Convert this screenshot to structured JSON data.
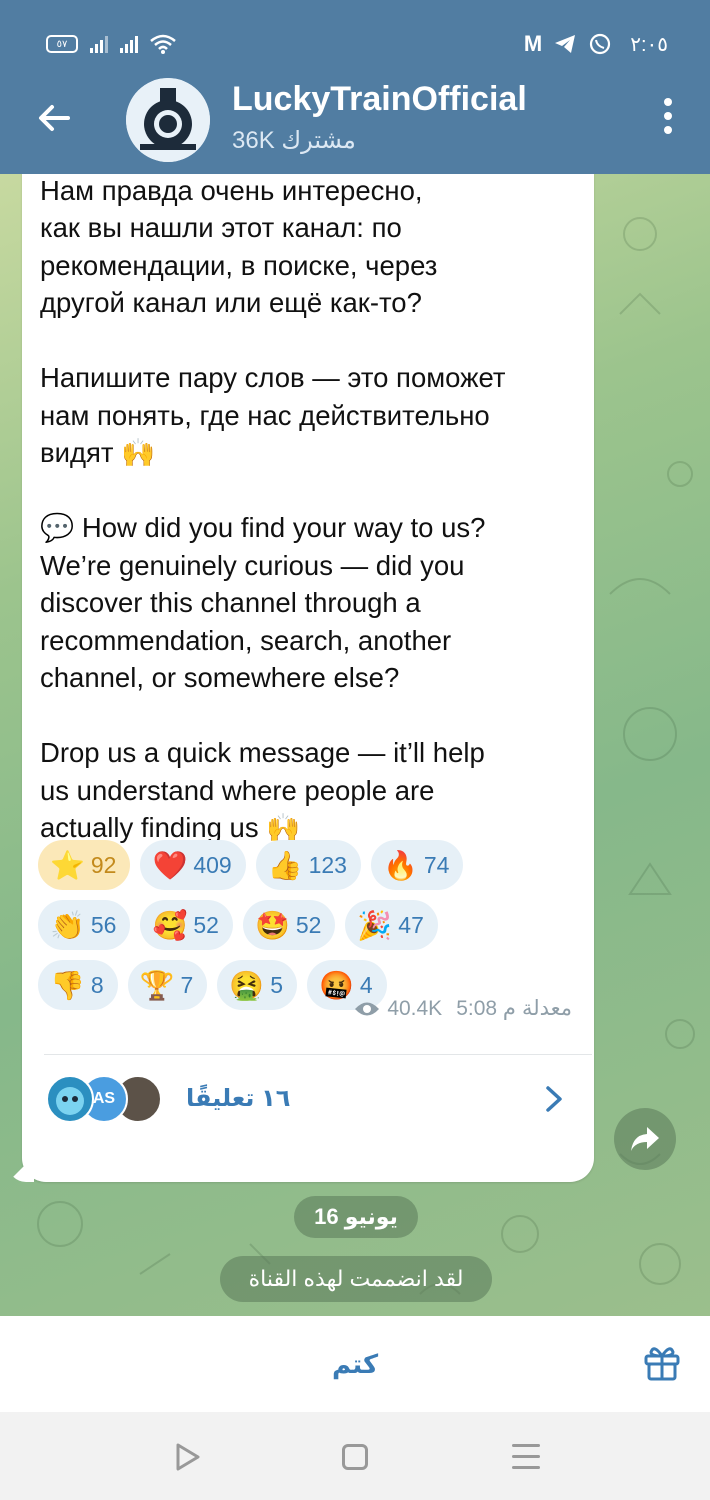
{
  "status_bar": {
    "time": "٢:٠٥",
    "battery": "٥٧"
  },
  "header": {
    "channel_name": "LuckyTrainOfficial",
    "subscribers": "36K مشترك"
  },
  "message": {
    "text": "💬 А вы откуда к нам попали?\nНам правда очень интересно,\nкак вы нашли этот канал: по\nрекомендации, в поиске, через\nдругой канал или ещё как-то?\n\nНапишите пару слов — это поможет\nнам понять, где нас действительно\nвидят 🙌\n\n💬 How did you find your way to us?\nWe’re genuinely curious — did you\ndiscover this channel through a\nrecommendation, search, another\nchannel, or somewhere else?\n\nDrop us a quick message — it’ll help\nus understand where people are\nactually finding us 🙌",
    "views": "40.4K",
    "time": "5:08 م",
    "edited": "معدلة",
    "comments_label": "١٦ تعليقًا",
    "comment_avatar_initials": "AS"
  },
  "reactions": [
    [
      {
        "emoji": "⭐",
        "count": "92",
        "active": true
      },
      {
        "emoji": "❤️",
        "count": "409"
      },
      {
        "emoji": "👍",
        "count": "123"
      },
      {
        "emoji": "🔥",
        "count": "74"
      }
    ],
    [
      {
        "emoji": "👏",
        "count": "56"
      },
      {
        "emoji": "🥰",
        "count": "52"
      },
      {
        "emoji": "🤩",
        "count": "52"
      },
      {
        "emoji": "🎉",
        "count": "47"
      }
    ],
    [
      {
        "emoji": "👎",
        "count": "8"
      },
      {
        "emoji": "🏆",
        "count": "7"
      },
      {
        "emoji": "🤮",
        "count": "5"
      },
      {
        "emoji": "🤬",
        "count": "4"
      }
    ]
  ],
  "service": {
    "date": "16 يونيو",
    "joined": "لقد انضممت لهذه القناة"
  },
  "bottom": {
    "mute_label": "كتم"
  },
  "colors": {
    "header_bg": "#517da2",
    "accent": "#3a7bb5"
  }
}
